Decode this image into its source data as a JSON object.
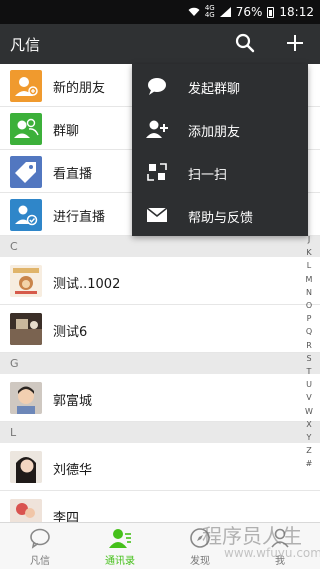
{
  "status_bar": {
    "network": "4G",
    "battery": "76%",
    "time": "18:12"
  },
  "header": {
    "title": "凡信"
  },
  "contacts": {
    "top_items": [
      {
        "label": "新的朋友",
        "color": "#f09a2e"
      },
      {
        "label": "群聊",
        "color": "#3cb03a"
      },
      {
        "label": "看直播",
        "color": "#5277c0"
      },
      {
        "label": "进行直播",
        "color": "#2f86c9"
      }
    ],
    "sections": [
      {
        "letter": "C",
        "items": [
          {
            "name": "测试..1002"
          },
          {
            "name": "测试6"
          }
        ]
      },
      {
        "letter": "G",
        "items": [
          {
            "name": "郭富城"
          }
        ]
      },
      {
        "letter": "L",
        "items": [
          {
            "name": "刘德华"
          },
          {
            "name": "李四"
          }
        ]
      }
    ]
  },
  "index_letters": [
    "J",
    "K",
    "L",
    "M",
    "N",
    "O",
    "P",
    "Q",
    "R",
    "S",
    "T",
    "U",
    "V",
    "W",
    "X",
    "Y",
    "Z",
    "#"
  ],
  "popup_menu": {
    "items": [
      {
        "label": "发起群聊",
        "icon": "chat-bubble-icon"
      },
      {
        "label": "添加朋友",
        "icon": "add-person-icon"
      },
      {
        "label": "扫一扫",
        "icon": "scan-icon"
      },
      {
        "label": "帮助与反馈",
        "icon": "mail-icon"
      }
    ]
  },
  "tabs": [
    {
      "label": "凡信",
      "active": false
    },
    {
      "label": "通讯录",
      "active": true
    },
    {
      "label": "发现",
      "active": false
    },
    {
      "label": "我",
      "active": false
    }
  ],
  "watermark": {
    "line1": "程序员人生",
    "line2": "www.wfuyu.com"
  },
  "colors": {
    "accent": "#45c01a",
    "header_bg": "#2f3133",
    "menu_bg": "#2d2f31"
  }
}
